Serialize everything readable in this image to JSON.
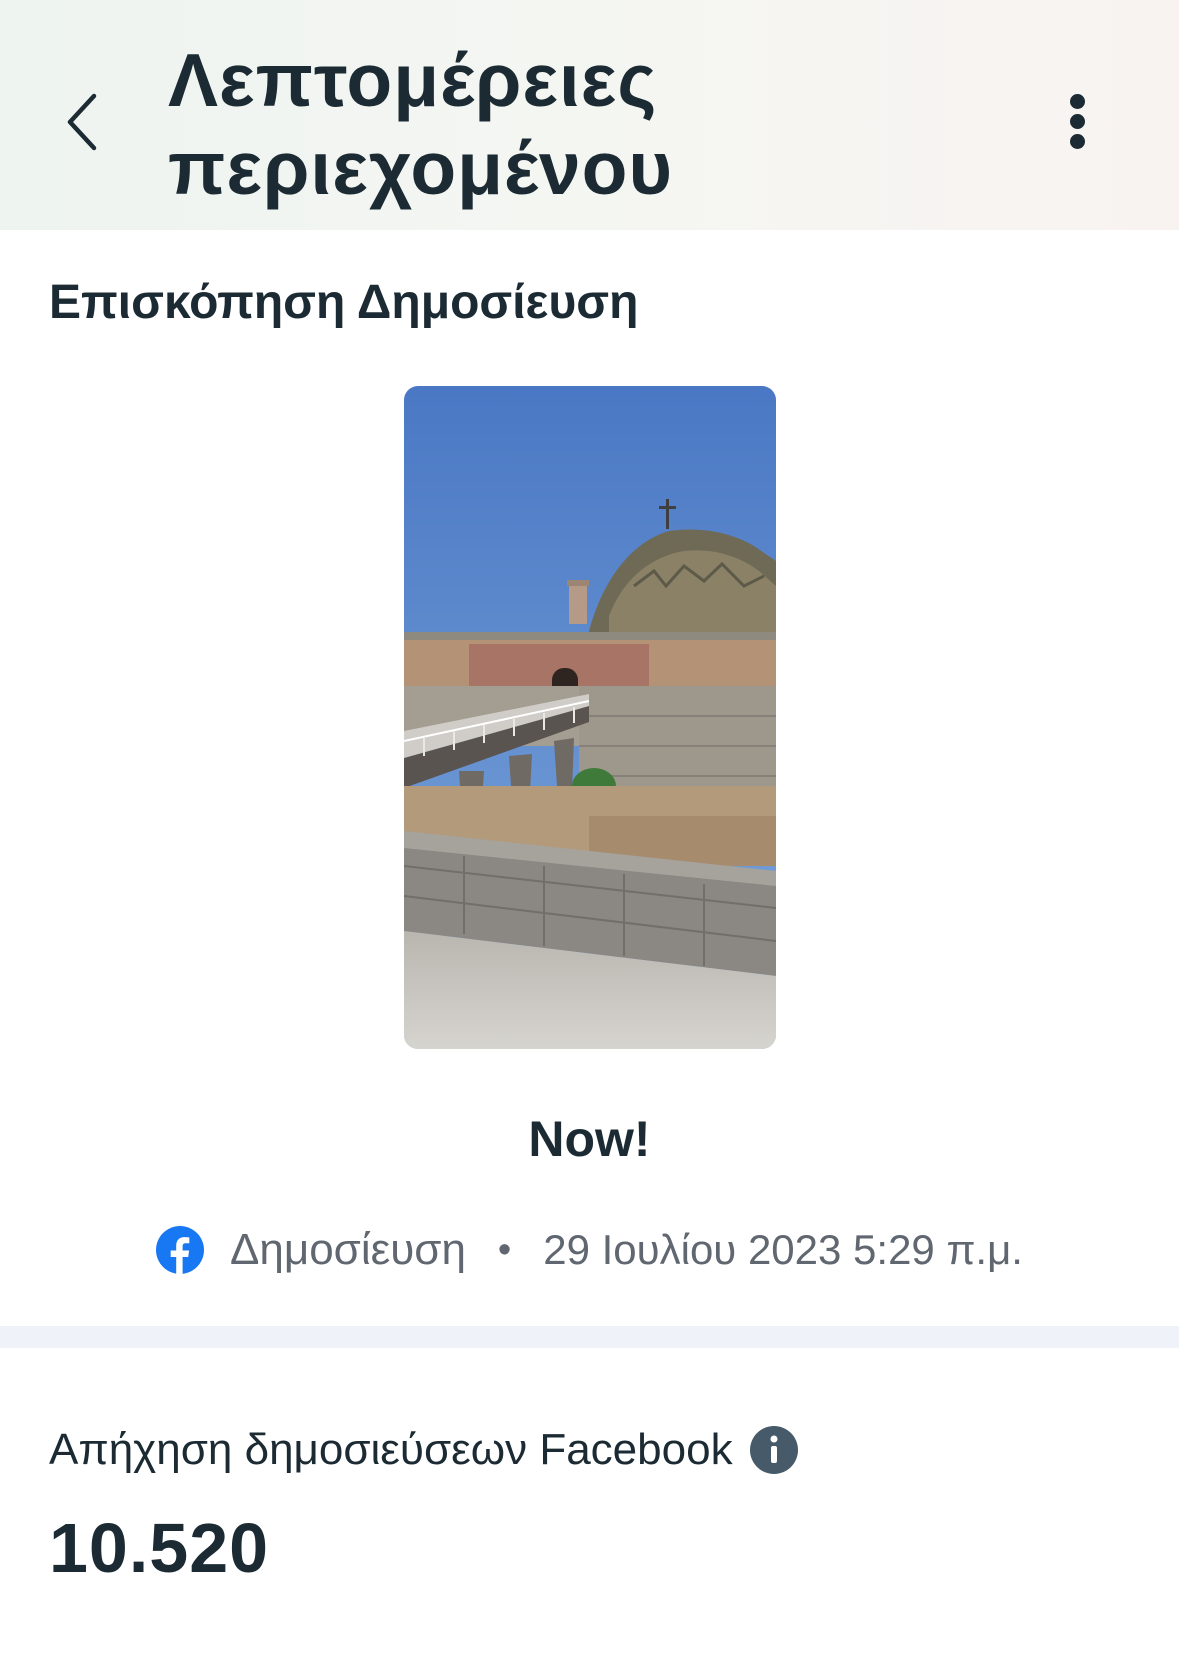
{
  "header": {
    "title": "Λεπτομέρειες περιεχομένου",
    "back_icon": "chevron-left-icon",
    "more_icon": "more-vertical-icon"
  },
  "preview": {
    "heading": "Επισκόπηση Δημοσίευση",
    "caption": "Now!",
    "platform_icon": "facebook-icon",
    "type": "Δημοσίευση",
    "separator": "•",
    "date": "29 Ιουλίου 2023 5:29 π.μ."
  },
  "metric": {
    "label": "Απήχηση δημοσιεύσεων Facebook",
    "info_icon": "info-icon",
    "value": "10.520"
  },
  "colors": {
    "text_primary": "#1c2b33",
    "text_secondary": "#606770",
    "facebook_blue": "#1877f2",
    "divider": "#eff2f8"
  }
}
